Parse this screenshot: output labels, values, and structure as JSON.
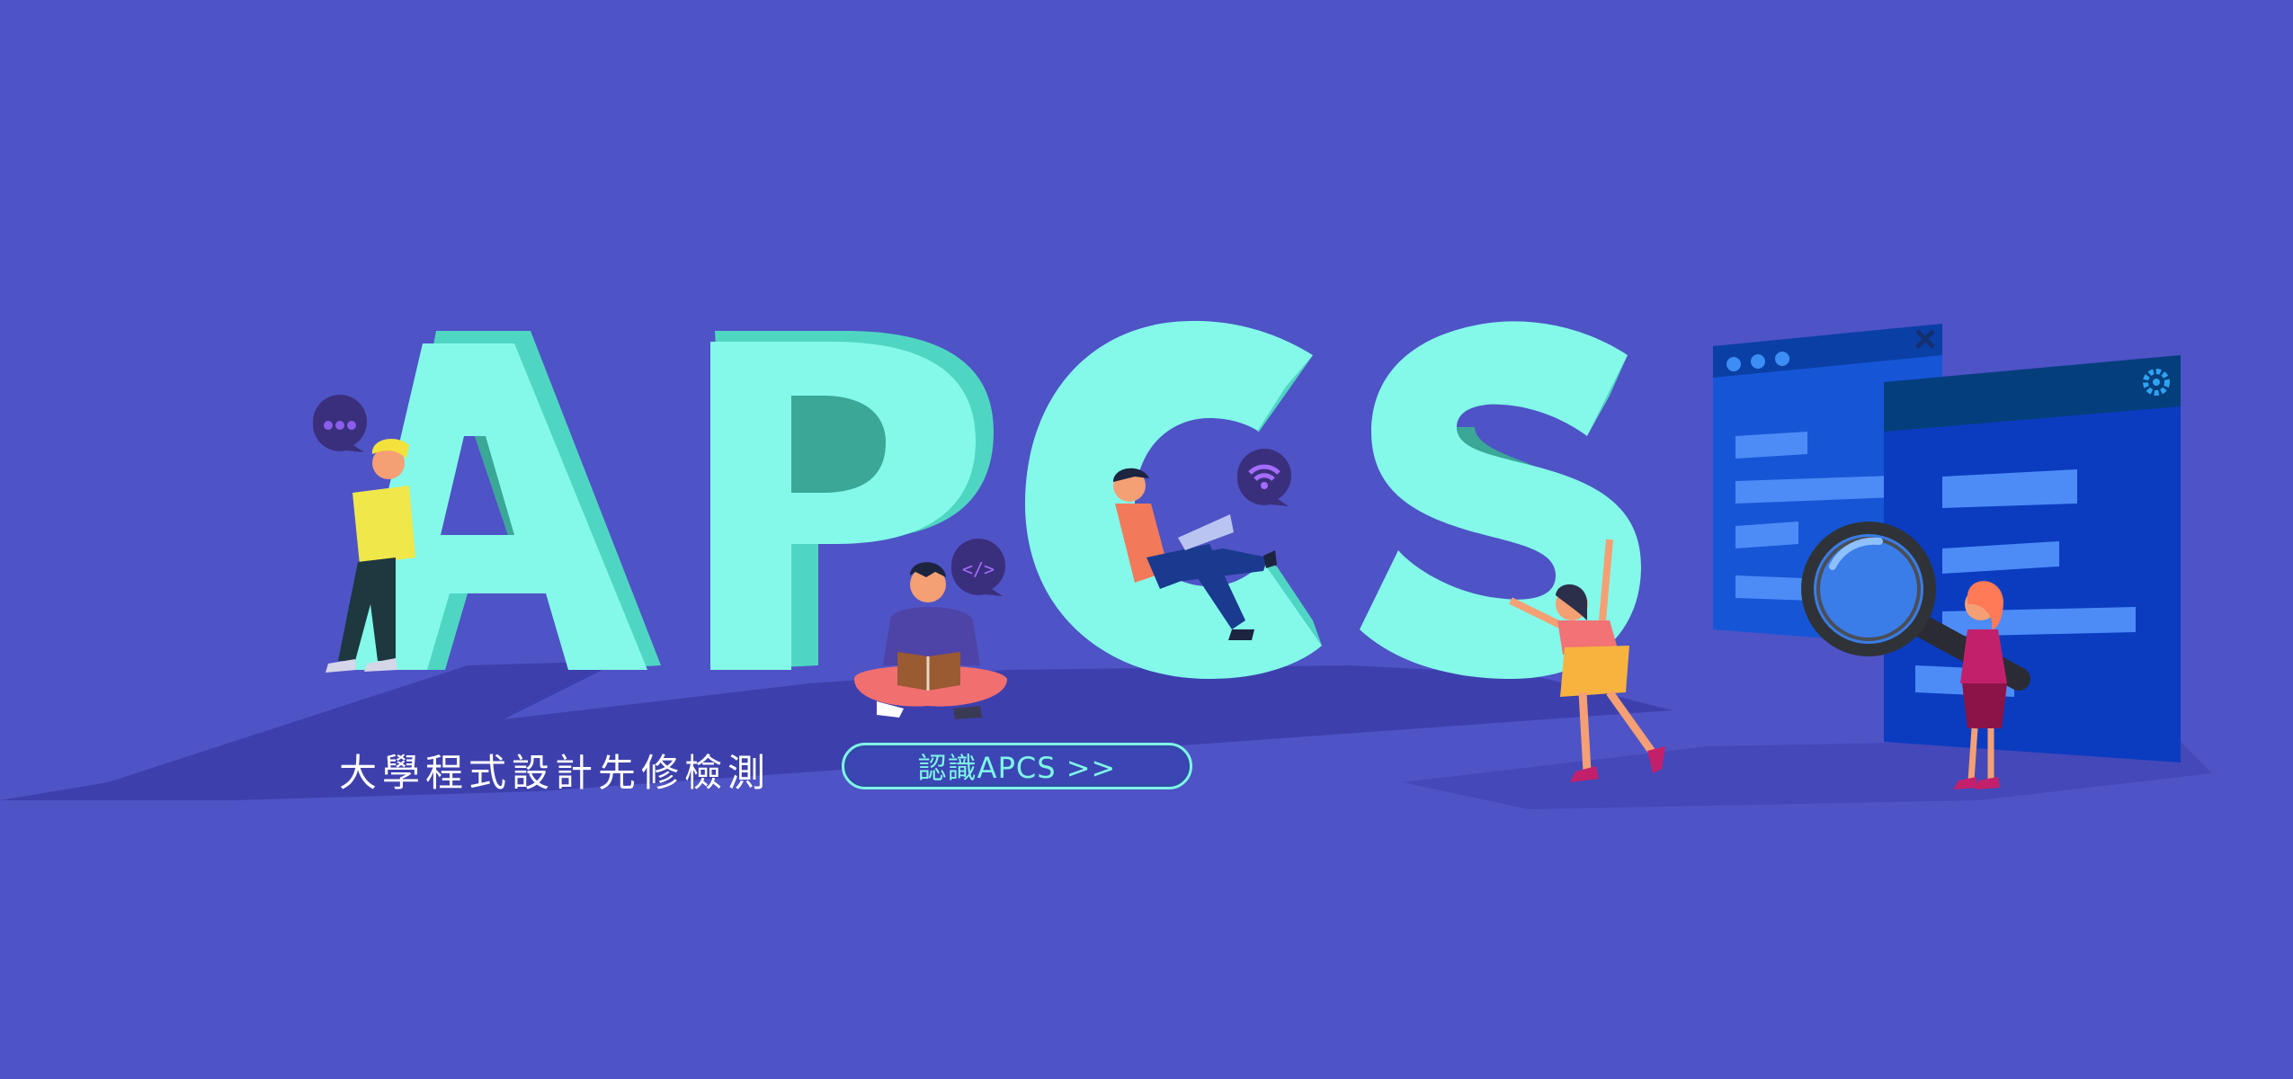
{
  "hero": {
    "headline": "APCS",
    "subtitle": "大學程式設計先修檢測",
    "cta_label": "認識APCS >>"
  },
  "icons": {
    "chat": "speech-bubble-dots-icon",
    "code": "code-tag-icon",
    "wifi": "wifi-icon",
    "window_close": "close-icon",
    "window_settings": "gear-icon",
    "magnifier": "magnifying-glass-icon"
  },
  "colors": {
    "background": "#4e53c6",
    "letters": "#84f9ea",
    "letter_side": "#4fd6c3",
    "cta_border": "#7ff7e6",
    "windows": "#1048c8"
  }
}
